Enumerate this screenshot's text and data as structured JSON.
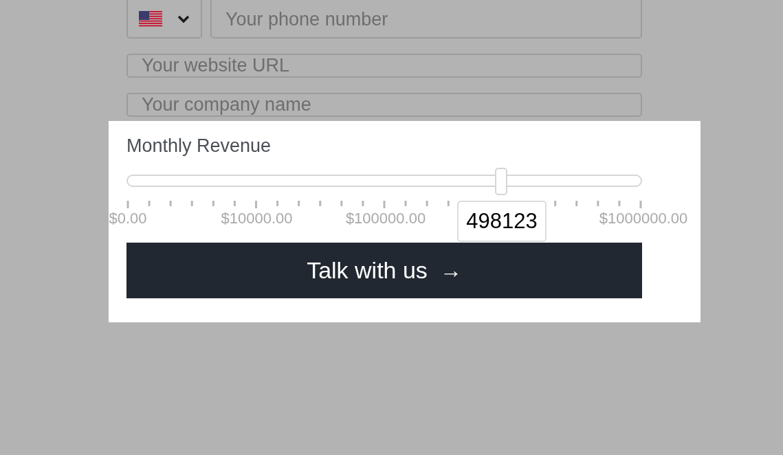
{
  "phone": {
    "placeholder": "Your phone number"
  },
  "website": {
    "placeholder": "Your website URL"
  },
  "company": {
    "placeholder": "Your company name"
  },
  "revenue": {
    "label": "Monthly Revenue",
    "level": 0.728,
    "value": "498123",
    "scale_labels": [
      "$0.00",
      "$10000.00",
      "$100000.00",
      "$1000000.00"
    ]
  },
  "submit": {
    "label": "Talk with us",
    "icon": "→"
  }
}
